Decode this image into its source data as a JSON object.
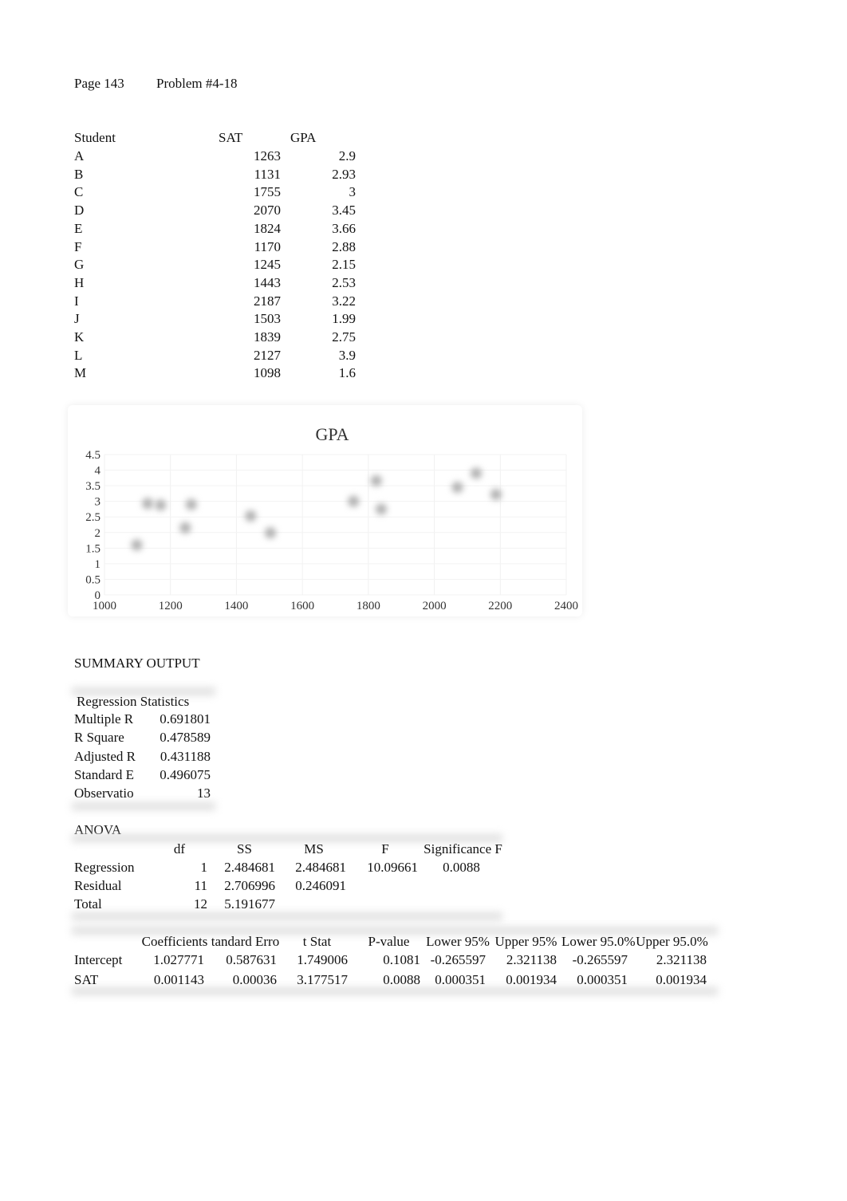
{
  "header": {
    "page": "Page 143",
    "problem": "Problem #4-18"
  },
  "data_table": {
    "headers": [
      "Student",
      "SAT",
      "GPA"
    ],
    "rows": [
      [
        "A",
        "1263",
        "2.9"
      ],
      [
        "B",
        "1131",
        "2.93"
      ],
      [
        "C",
        "1755",
        "3"
      ],
      [
        "D",
        "2070",
        "3.45"
      ],
      [
        "E",
        "1824",
        "3.66"
      ],
      [
        "F",
        "1170",
        "2.88"
      ],
      [
        "G",
        "1245",
        "2.15"
      ],
      [
        "H",
        "1443",
        "2.53"
      ],
      [
        "I",
        "2187",
        "3.22"
      ],
      [
        "J",
        "1503",
        "1.99"
      ],
      [
        "K",
        "1839",
        "2.75"
      ],
      [
        "L",
        "2127",
        "3.9"
      ],
      [
        "M",
        "1098",
        "1.6"
      ]
    ]
  },
  "chart_data": {
    "type": "scatter",
    "title": "GPA",
    "xlabel": "",
    "ylabel": "",
    "xlim": [
      1000,
      2400
    ],
    "ylim": [
      0,
      4.5
    ],
    "xticks": [
      "1000",
      "1200",
      "1400",
      "1600",
      "1800",
      "2000",
      "2200",
      "2400"
    ],
    "yticks": [
      "0",
      "0.5",
      "1",
      "1.5",
      "2",
      "2.5",
      "3",
      "3.5",
      "4",
      "4.5"
    ],
    "grid": true,
    "legend": "none",
    "series": [
      {
        "name": "GPA",
        "x": [
          1263,
          1131,
          1755,
          2070,
          1824,
          1170,
          1245,
          1443,
          2187,
          1503,
          1839,
          2127,
          1098
        ],
        "y": [
          2.9,
          2.93,
          3,
          3.45,
          3.66,
          2.88,
          2.15,
          2.53,
          3.22,
          1.99,
          2.75,
          3.9,
          1.6
        ]
      }
    ]
  },
  "summary": {
    "title": "SUMMARY OUTPUT",
    "regstats": {
      "header": "Regression Statistics",
      "rows": [
        [
          "Multiple R",
          "0.691801"
        ],
        [
          "R Square",
          "0.478589"
        ],
        [
          "Adjusted R",
          "0.431188"
        ],
        [
          "Standard E",
          "0.496075"
        ],
        [
          "Observatio",
          "13"
        ]
      ]
    },
    "anova": {
      "title": "ANOVA",
      "headers": [
        "",
        "df",
        "SS",
        "MS",
        "F",
        "Significance F"
      ],
      "rows": [
        [
          "Regression",
          "1",
          "2.484681",
          "2.484681",
          "10.09661",
          "0.0088"
        ],
        [
          "Residual",
          "11",
          "2.706996",
          "0.246091",
          "",
          ""
        ],
        [
          "Total",
          "12",
          "5.191677",
          "",
          "",
          ""
        ]
      ]
    },
    "coef": {
      "headers": [
        "",
        "Coefficients",
        "tandard Erro",
        "t Stat",
        "P-value",
        "Lower 95%",
        "Upper 95%",
        "Lower 95.0%",
        "Upper 95.0%"
      ],
      "rows": [
        [
          "Intercept",
          "1.027771",
          "0.587631",
          "1.749006",
          "0.1081",
          "-0.265597",
          "2.321138",
          "-0.265597",
          "2.321138"
        ],
        [
          "SAT",
          "0.001143",
          "0.00036",
          "3.177517",
          "0.0088",
          "0.000351",
          "0.001934",
          "0.000351",
          "0.001934"
        ]
      ]
    }
  }
}
